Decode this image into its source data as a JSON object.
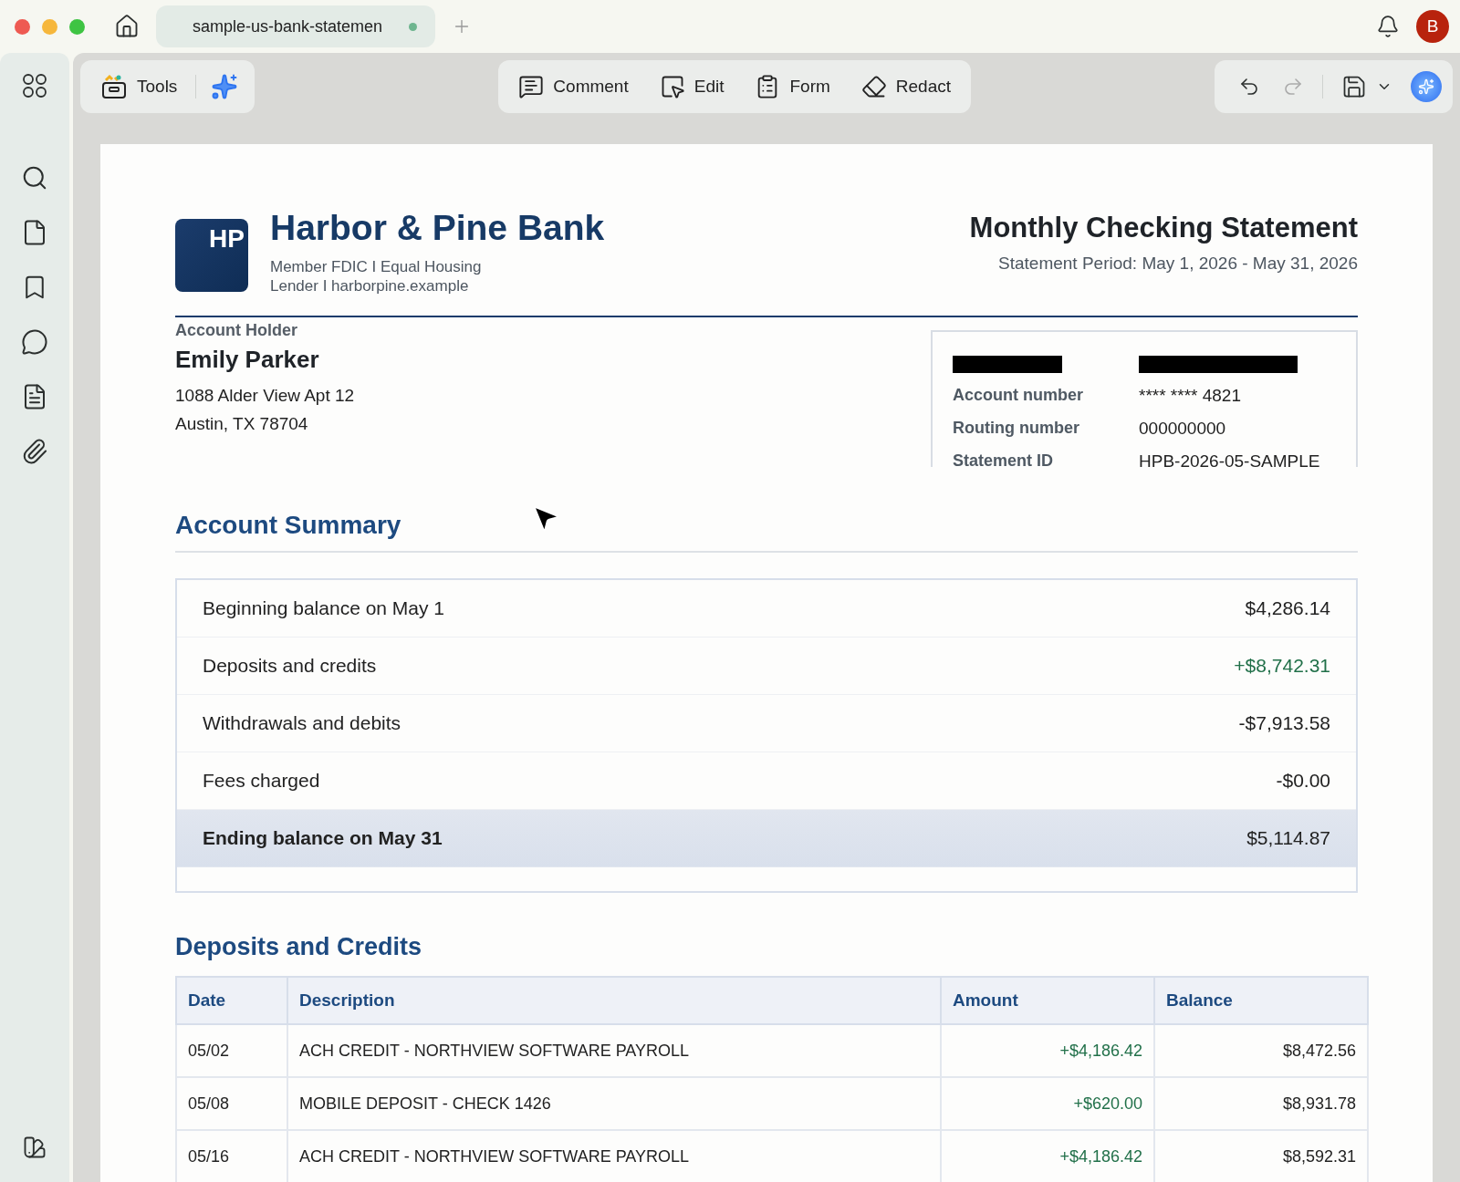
{
  "tab_bar": {
    "tab": {
      "title": "sample-us-bank-statemen",
      "unsaved": true
    },
    "avatar": "B"
  },
  "toolbar": {
    "tools_label": "Tools",
    "actions": [
      {
        "kind": "comment",
        "label": "Comment"
      },
      {
        "kind": "edit",
        "label": "Edit"
      },
      {
        "kind": "form",
        "label": "Form"
      },
      {
        "kind": "redact",
        "label": "Redact"
      }
    ]
  },
  "document": {
    "logo": "HP",
    "bank_name": "Harbor & Pine Bank",
    "bank_info": "Member FDIC I Equal Housing Lender I harborpine.example",
    "title": "Monthly Checking Statement",
    "period": "Statement Period: May 1, 2026 - May 31, 2026",
    "holder": {
      "label": "Account Holder",
      "name": "Emily Parker",
      "address_lines": [
        "1088 Alder View Apt 12",
        "Austin, TX 78704"
      ]
    },
    "account_details": [
      {
        "label": "Account number",
        "value": "**** **** 4821"
      },
      {
        "label": "Routing number",
        "value": "000000000"
      },
      {
        "label": "Statement ID",
        "value": "HPB-2026-05-SAMPLE"
      }
    ],
    "summary": {
      "title": "Account Summary",
      "rows": [
        {
          "kind": "plain",
          "label": "Beginning balance on May 1",
          "amount": "$4,286.14"
        },
        {
          "kind": "credit",
          "label": "Deposits and credits",
          "amount": "+$8,742.31"
        },
        {
          "kind": "plain",
          "label": "Withdrawals and debits",
          "amount": "-$7,913.58"
        },
        {
          "kind": "plain",
          "label": "Fees charged",
          "amount": "-$0.00"
        },
        {
          "kind": "total",
          "label": "Ending balance on May 31",
          "amount": "$5,114.87"
        }
      ]
    },
    "deposits": {
      "title": "Deposits and Credits",
      "columns": [
        "Date",
        "Description",
        "Amount",
        "Balance"
      ],
      "rows": [
        [
          "05/02",
          "ACH CREDIT - NORTHVIEW SOFTWARE PAYROLL",
          "+$4,186.42",
          "$8,472.56"
        ],
        [
          "05/08",
          "MOBILE DEPOSIT - CHECK 1426",
          "+$620.00",
          "$8,931.78"
        ],
        [
          "05/16",
          "ACH CREDIT - NORTHVIEW SOFTWARE PAYROLL",
          "+$4,186.42",
          "$8,592.31"
        ]
      ]
    }
  }
}
